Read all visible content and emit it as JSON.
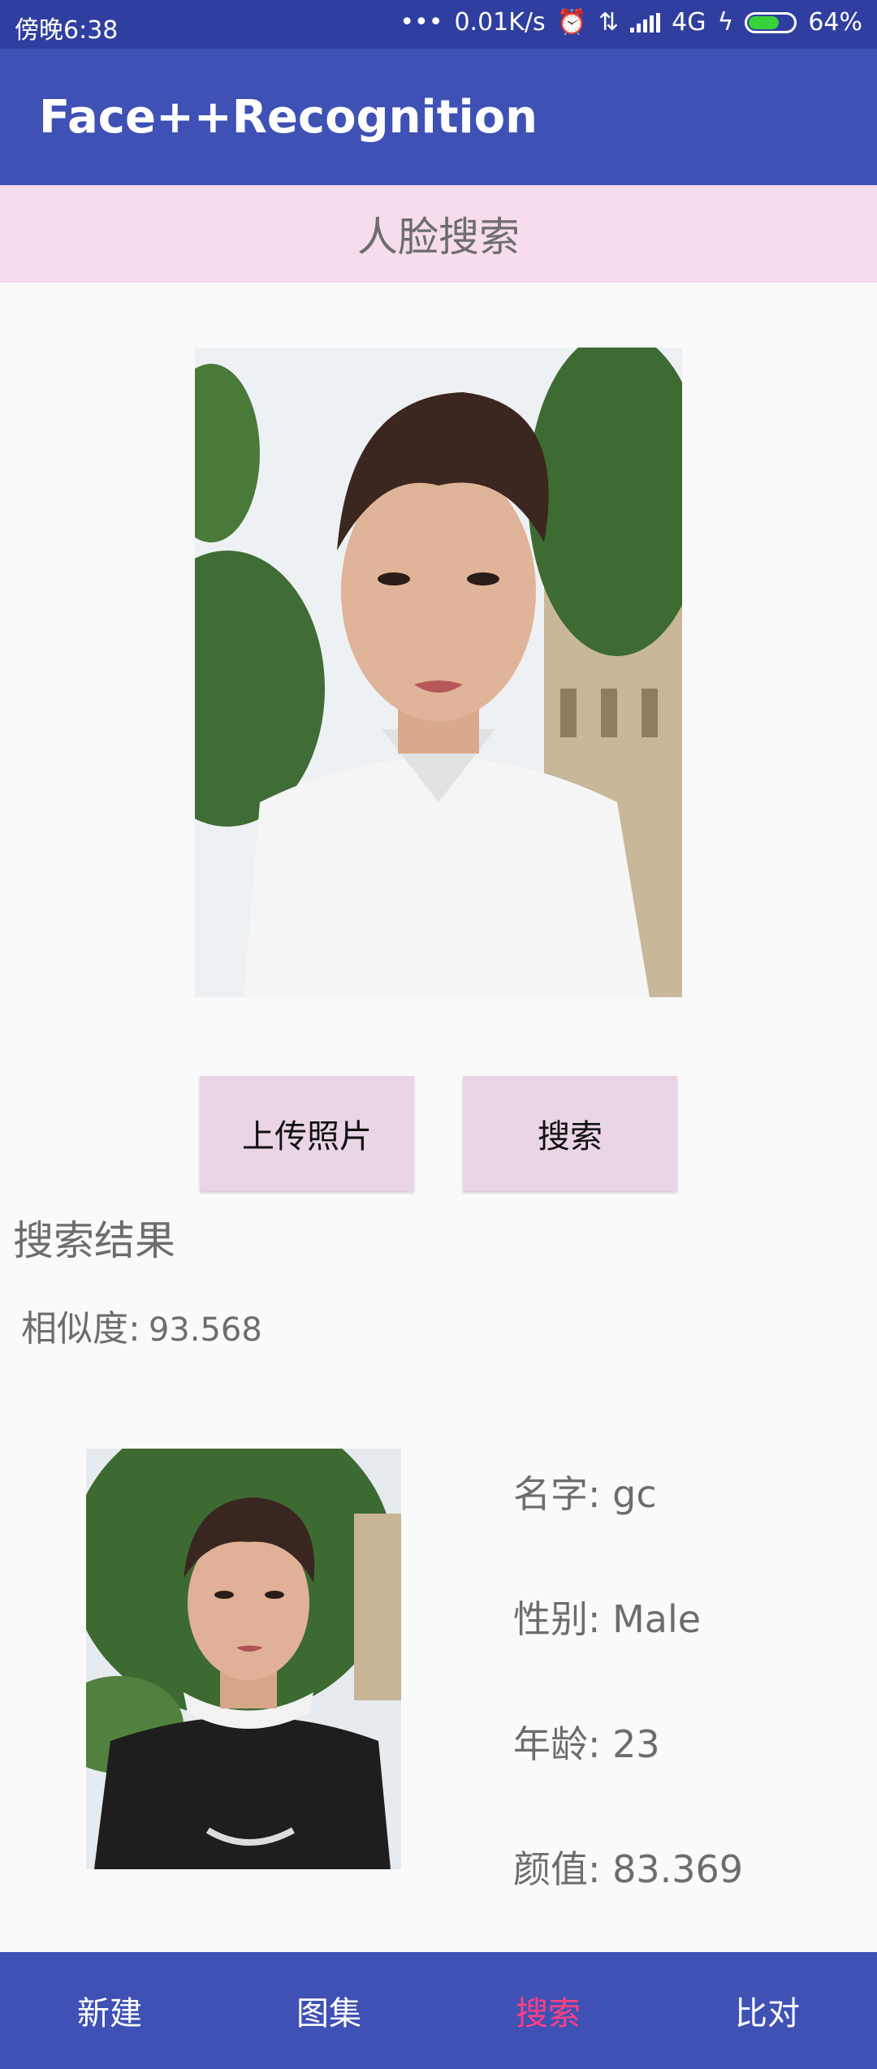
{
  "status_bar": {
    "time": "傍晚6:38",
    "dots": "•••",
    "speed": "0.01K/s",
    "network": "4G",
    "battery": "64%",
    "battery_level": 0.64,
    "icons": [
      "alarm-icon",
      "data-transfer-icon",
      "signal-icon",
      "charging-icon",
      "battery-icon"
    ]
  },
  "app_bar": {
    "title": "Face++Recognition"
  },
  "section": {
    "title": "人脸搜索"
  },
  "buttons": {
    "upload": "上传照片",
    "search": "搜索"
  },
  "results": {
    "title": "搜索结果",
    "similarity_label": "相似度:",
    "similarity_value": "93.568",
    "name": "名字: gc",
    "gender": "性别: Male",
    "age": "年龄: 23",
    "score": "颜值: 83.369"
  },
  "bottom_nav": {
    "items": [
      {
        "label": "新建",
        "active": false
      },
      {
        "label": "图集",
        "active": false
      },
      {
        "label": "搜索",
        "active": true
      },
      {
        "label": "比对",
        "active": false
      }
    ]
  },
  "colors": {
    "status_bar": "#303f9f",
    "primary": "#3f51b5",
    "accent": "#ff4081",
    "header_bg": "#f6dcec",
    "button_bg": "#ead5e6"
  }
}
